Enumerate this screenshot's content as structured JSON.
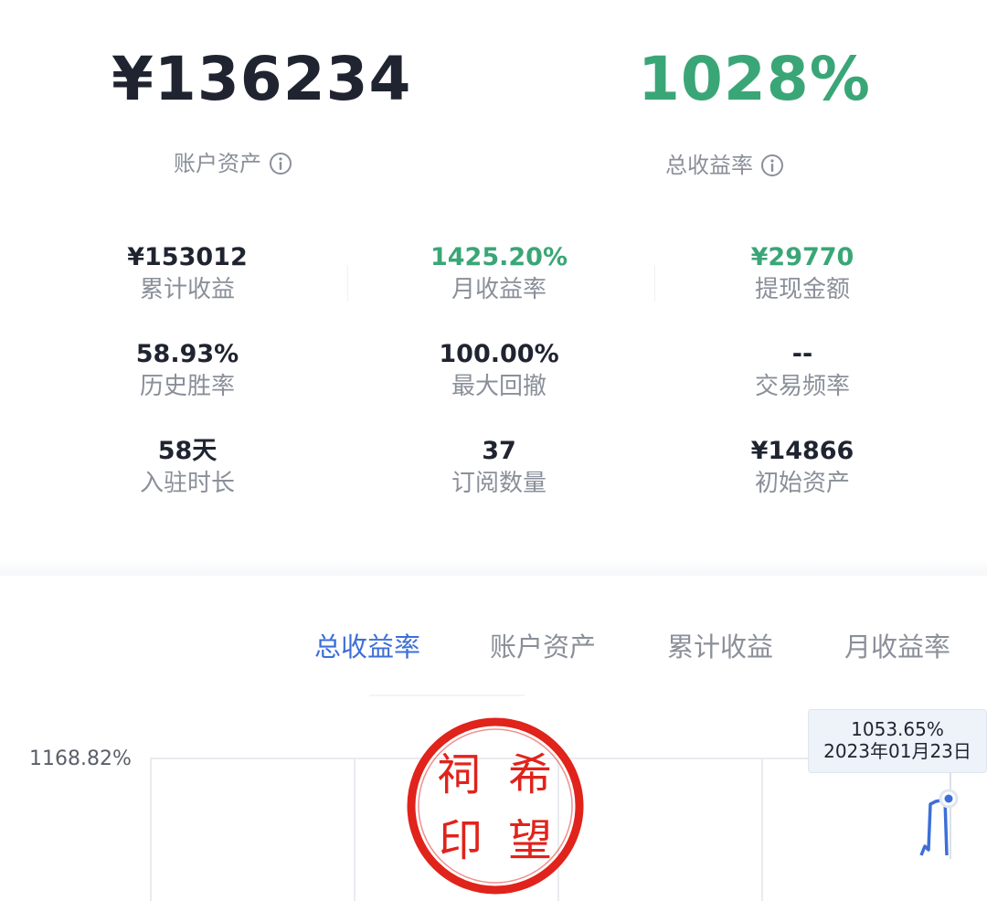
{
  "summary": {
    "account_asset_value": "¥136234",
    "account_asset_label": "账户资产",
    "total_return_value": "1028%",
    "total_return_label": "总收益率",
    "info_icon": "info-circle-icon"
  },
  "stats": [
    {
      "value": "¥153012",
      "label": "累计收益",
      "color": "#1f2430"
    },
    {
      "value": "1425.20%",
      "label": "月收益率",
      "color": "#3aa677"
    },
    {
      "value": "¥29770",
      "label": "提现金额",
      "color": "#3aa677"
    },
    {
      "value": "58.93%",
      "label": "历史胜率",
      "color": "#1f2430"
    },
    {
      "value": "100.00%",
      "label": "最大回撤",
      "color": "#1f2430"
    },
    {
      "value": "--",
      "label": "交易频率",
      "color": "#1f2430"
    },
    {
      "value": "58天",
      "label": "入驻时长",
      "color": "#1f2430"
    },
    {
      "value": "37",
      "label": "订阅数量",
      "color": "#1f2430"
    },
    {
      "value": "¥14866",
      "label": "初始资产",
      "color": "#1f2430"
    }
  ],
  "tabs": [
    {
      "label": "总收益率",
      "active": true
    },
    {
      "label": "账户资产",
      "active": false
    },
    {
      "label": "累计收益",
      "active": false
    },
    {
      "label": "月收益率",
      "active": false
    }
  ],
  "chart": {
    "y_tick_label": "1168.82%",
    "tooltip_value": "1053.65%",
    "tooltip_date": "2023年01月23日",
    "line_color": "#3d6fd8"
  },
  "seal": {
    "characters": [
      "祠",
      "希",
      "印",
      "望"
    ],
    "color": "#e0231b"
  },
  "colors": {
    "accent_green": "#3aa677",
    "accent_blue": "#3d6fd8",
    "text_primary": "#1f2430",
    "text_secondary": "#8a8f99"
  }
}
